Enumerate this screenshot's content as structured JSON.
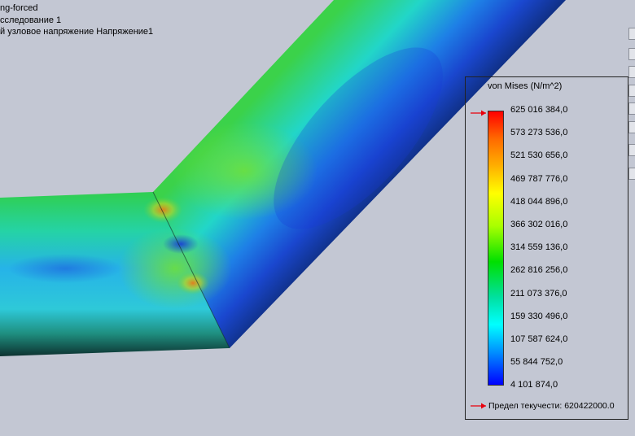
{
  "header": {
    "line1": "ng-forced",
    "line2": "сследование 1",
    "line3": "й узловое напряжение Напряжение1"
  },
  "legend": {
    "title": "von Mises (N/m^2)",
    "ticks": [
      "625 016 384,0",
      "573 273 536,0",
      "521 530 656,0",
      "469 787 776,0",
      "418 044 896,0",
      "366 302 016,0",
      "314 559 136,0",
      "262 816 256,0",
      "211 073 376,0",
      "159 330 496,0",
      "107 587 624,0",
      "55 844 752,0",
      "4 101 874,0"
    ],
    "yield_label": "Предел текучести: 620422000.0",
    "arrow_color": "#e8000c"
  },
  "colors": {
    "background": "#c3c7d3",
    "max": "#ff0000",
    "min": "#0000ff"
  }
}
